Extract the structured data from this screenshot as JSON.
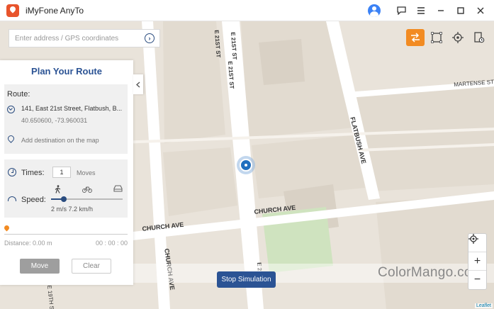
{
  "app": {
    "title": "iMyFone AnyTo"
  },
  "titlebar": {
    "icons": [
      "user-avatar-icon",
      "feedback-icon",
      "menu-icon",
      "minimize-icon",
      "maximize-icon",
      "close-icon"
    ]
  },
  "search": {
    "placeholder": "Enter address / GPS coordinates"
  },
  "modes": [
    "multi-spot-route-icon",
    "two-spot-route-icon",
    "teleport-icon",
    "history-icon"
  ],
  "panel": {
    "title": "Plan Your Route",
    "route_label": "Route:",
    "address": "141, East 21st Street, Flatbush, B...",
    "coords": "40.650600, -73.960031",
    "add_destination": "Add destination on the map",
    "times_label": "Times:",
    "times_value": "1",
    "times_unit": "Moves",
    "speed_label": "Speed:",
    "speed_value": "2 m/s 7.2 km/h",
    "speed_fraction": 0.18,
    "distance": "Distance: 0.00 m",
    "timer": "00 : 00 : 00",
    "move_label": "Move",
    "clear_label": "Clear"
  },
  "map": {
    "streets": [
      "E 21ST ST",
      "E 21ST ST",
      "E 21ST ST",
      "FLATBUSH AVE",
      "CHURCH AVE",
      "CHURCH AVE",
      "CHURCH AVE",
      "MARTENSE ST",
      "E 19TH ST",
      "E 2"
    ],
    "stop_label": "Stop Simulation",
    "zoom_in": "+",
    "zoom_out": "−",
    "attribution": "Leaflet"
  },
  "watermark": "ColorMango.com",
  "colors": {
    "accent": "#f28b22",
    "primary": "#2b5394",
    "map_bg": "#e9e3da",
    "road": "#ffffff",
    "park": "#cfe3bf"
  }
}
